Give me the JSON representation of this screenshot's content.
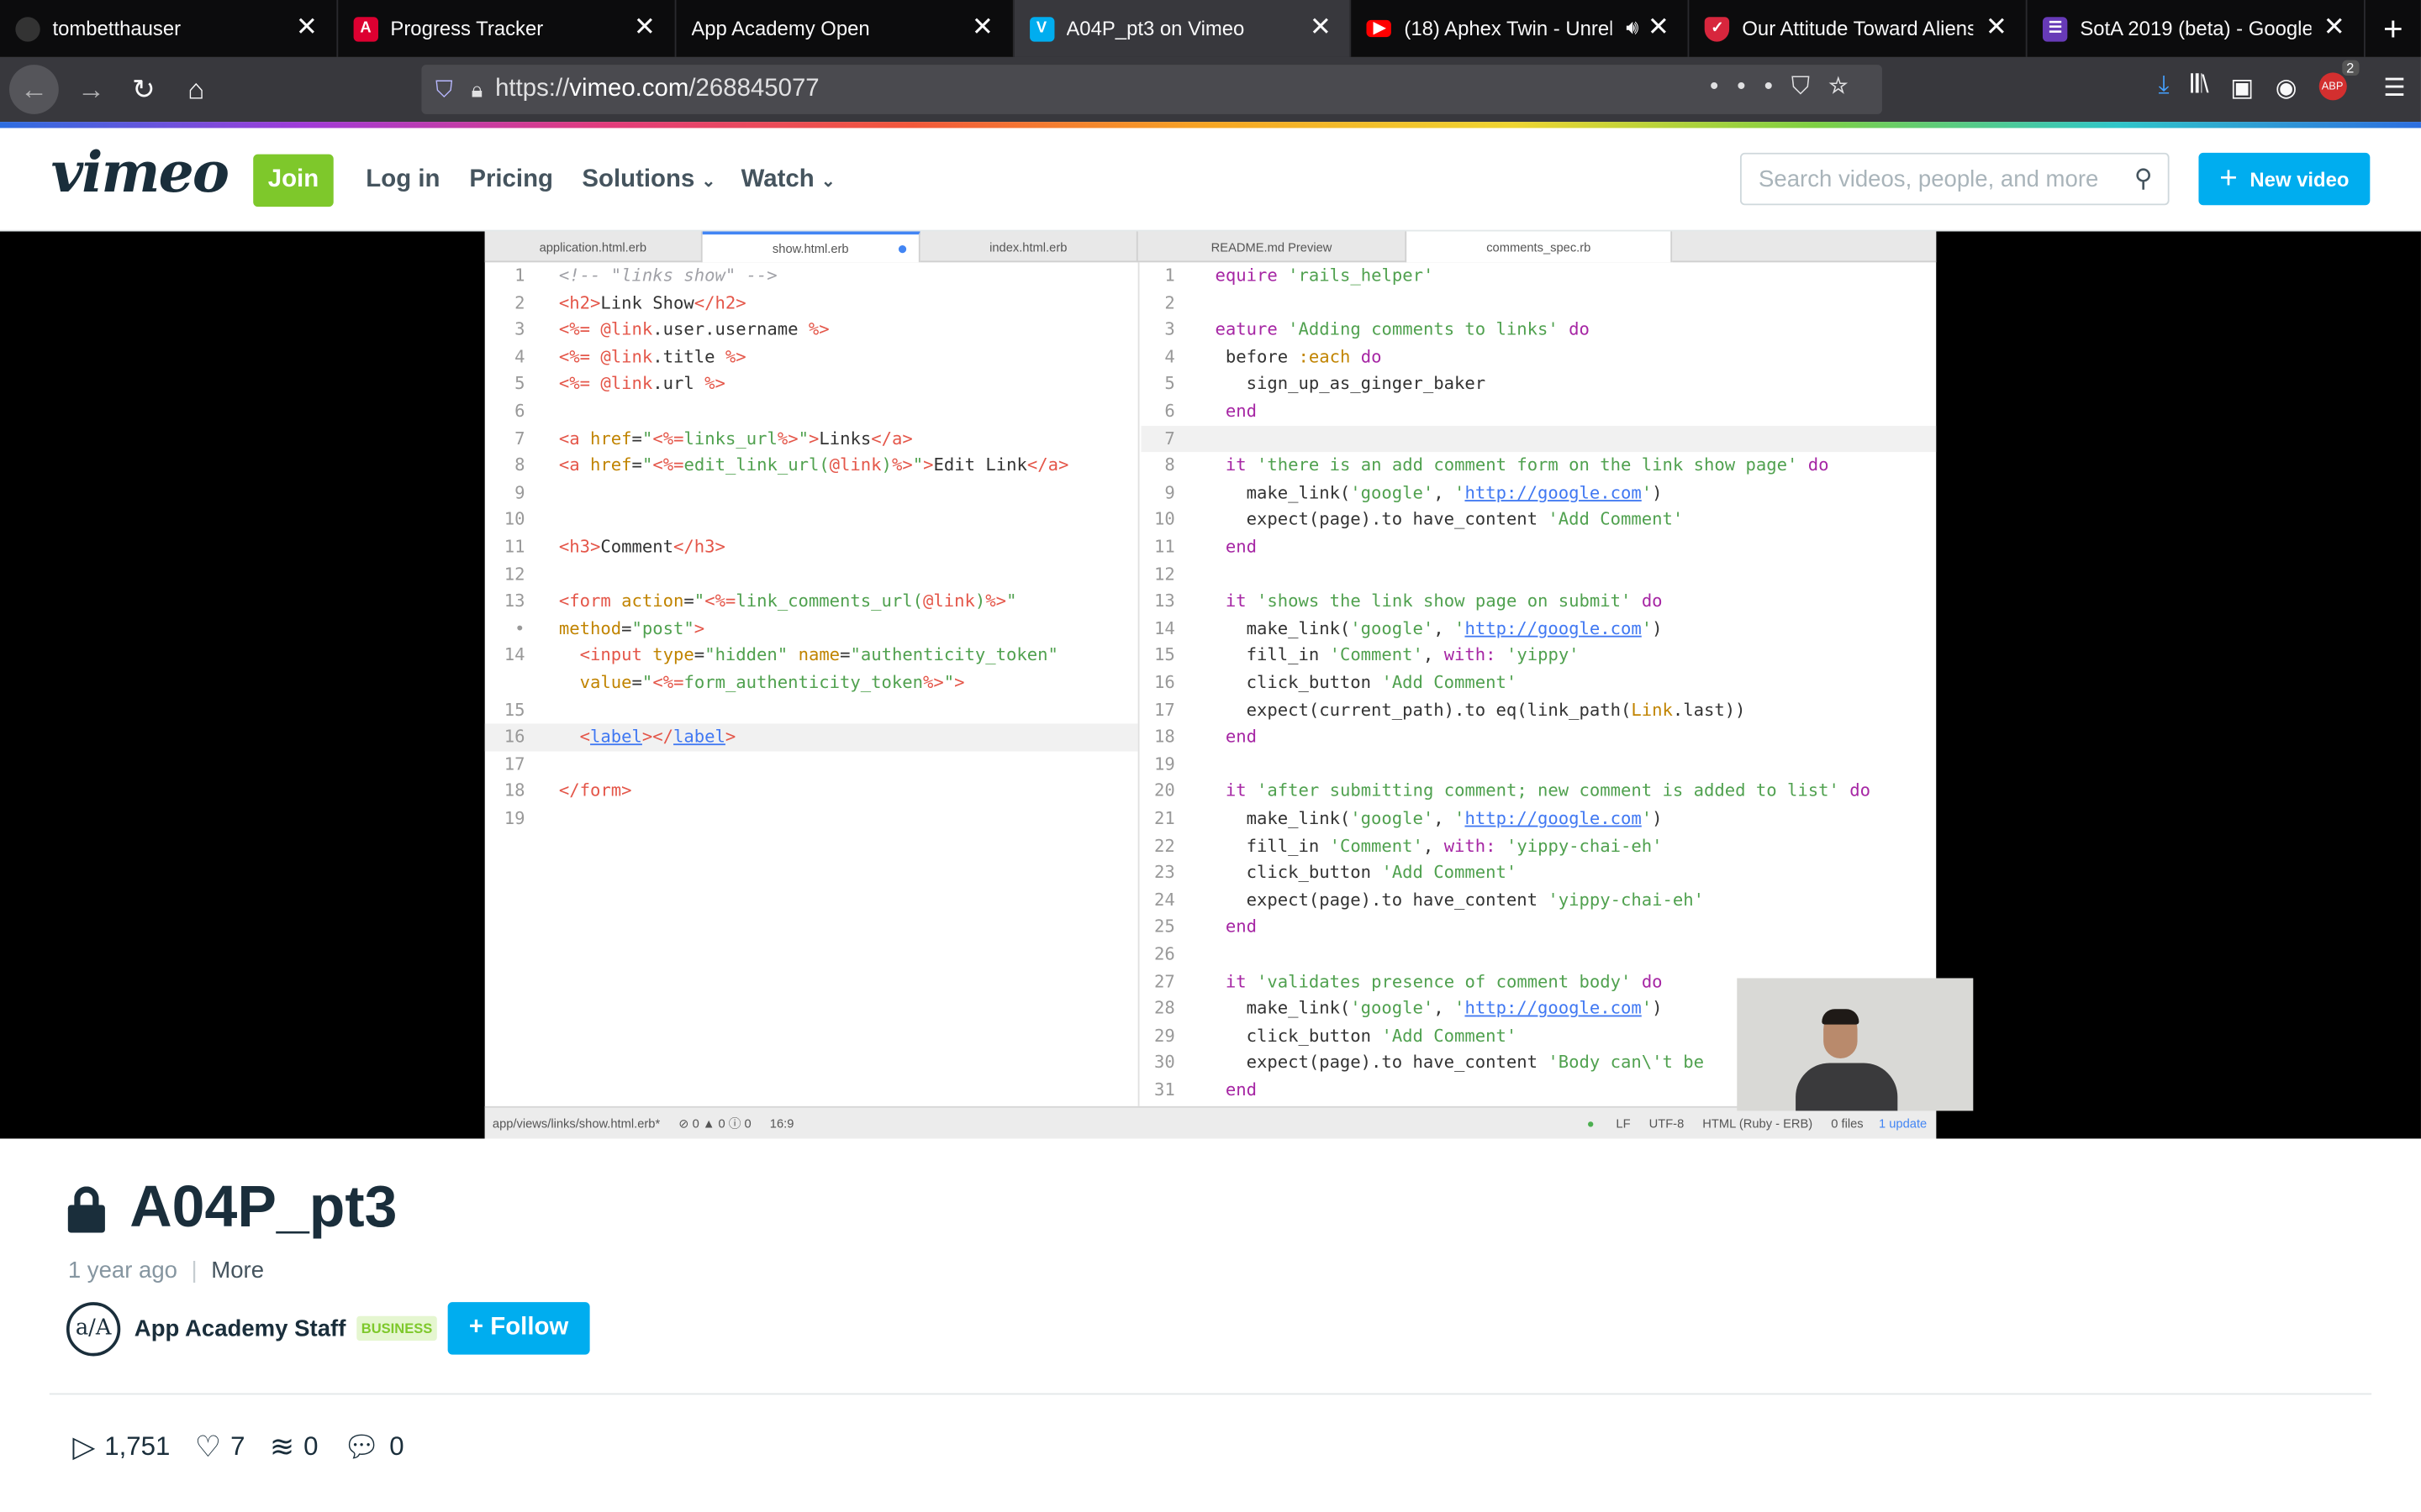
{
  "browser": {
    "tabs": [
      {
        "title": "tombetthauser",
        "icon_color": "#333333",
        "icon": "github-icon"
      },
      {
        "title": "Progress Tracker",
        "icon_color": "#dd0031",
        "icon": "angular-icon"
      },
      {
        "title": "App Academy Open",
        "icon_color": "#0c0c0d",
        "icon": "blank-icon"
      },
      {
        "title": "A04P_pt3 on Vimeo",
        "icon_color": "#00adef",
        "icon": "vimeo-icon",
        "active": true
      },
      {
        "title": "(18) Aphex Twin - Unrel",
        "icon_color": "#ff0000",
        "icon": "youtube-icon"
      },
      {
        "title": "Our Attitude Toward Aliens",
        "icon_color": "#d7263d",
        "icon": "pocket-icon"
      },
      {
        "title": "SotA 2019 (beta) - Google",
        "icon_color": "#673ab7",
        "icon": "forms-icon"
      }
    ],
    "url_prefix": "https://",
    "url_domain": "vimeo.com",
    "url_path": "/268845077",
    "notification_count": "2",
    "adblock_label": "ABP"
  },
  "header": {
    "logo": "vimeo",
    "join_label": "Join",
    "login_label": "Log in",
    "pricing_label": "Pricing",
    "solutions_label": "Solutions",
    "watch_label": "Watch",
    "search_placeholder": "Search videos, people, and more",
    "new_video_label": "New video"
  },
  "editor": {
    "tabs": [
      "application.html.erb",
      "show.html.erb",
      "index.html.erb",
      "README.md Preview",
      "comments_spec.rb"
    ],
    "left_lines": [
      {
        "n": "1",
        "html": "<span class='cm'>&lt;!-- \"links show\" --&gt;</span>"
      },
      {
        "n": "2",
        "html": "<span class='tg'>&lt;h2&gt;</span>Link Show<span class='tg'>&lt;/h2&gt;</span>"
      },
      {
        "n": "3",
        "html": "<span class='tg'>&lt;%=</span> <span class='tg'>@link</span>.user.username <span class='tg'>%&gt;</span>"
      },
      {
        "n": "4",
        "html": "<span class='tg'>&lt;%=</span> <span class='tg'>@link</span>.title <span class='tg'>%&gt;</span>"
      },
      {
        "n": "5",
        "html": "<span class='tg'>&lt;%=</span> <span class='tg'>@link</span>.url <span class='tg'>%&gt;</span>"
      },
      {
        "n": "6",
        "html": ""
      },
      {
        "n": "7",
        "html": "<span class='tg'>&lt;a</span> <span class='cn'>href</span>=<span class='st'>\"<span class='tg'>&lt;%=</span>links_url<span class='tg'>%&gt;</span>\"</span><span class='tg'>&gt;</span>Links<span class='tg'>&lt;/a&gt;</span>"
      },
      {
        "n": "8",
        "html": "<span class='tg'>&lt;a</span> <span class='cn'>href</span>=<span class='st'>\"<span class='tg'>&lt;%=</span>edit_link_url(<span class='tg'>@link</span>)<span class='tg'>%&gt;</span>\"</span><span class='tg'>&gt;</span>Edit Link<span class='tg'>&lt;/a&gt;</span>"
      },
      {
        "n": "9",
        "html": ""
      },
      {
        "n": "10",
        "html": ""
      },
      {
        "n": "11",
        "html": "<span class='tg'>&lt;h3&gt;</span>Comment<span class='tg'>&lt;/h3&gt;</span>"
      },
      {
        "n": "12",
        "html": ""
      },
      {
        "n": "13",
        "html": "<span class='tg'>&lt;form</span> <span class='cn'>action</span>=<span class='st'>\"<span class='tg'>&lt;%=</span>link_comments_url(<span class='tg'>@link</span>)<span class='tg'>%&gt;</span>\"</span>"
      },
      {
        "n": "•",
        "html": "<span class='cn'>method</span>=<span class='st'>\"post\"</span><span class='tg'>&gt;</span>"
      },
      {
        "n": "14",
        "html": "  <span class='tg'>&lt;input</span> <span class='cn'>type</span>=<span class='st'>\"hidden\"</span> <span class='cn'>name</span>=<span class='st'>\"authenticity_token\"</span>"
      },
      {
        "n": "",
        "html": "  <span class='cn'>value</span>=<span class='st'>\"<span class='tg'>&lt;%=</span>form_authenticity_token<span class='tg'>%&gt;</span>\"</span><span class='tg'>&gt;</span>"
      },
      {
        "n": "15",
        "html": ""
      },
      {
        "n": "16",
        "html": "  <span class='tg'>&lt;</span><span class='lk'>label</span><span class='tg'>&gt;&lt;/</span><span class='lk'>label</span><span class='tg'>&gt;</span>",
        "hl": true
      },
      {
        "n": "17",
        "html": ""
      },
      {
        "n": "18",
        "html": "<span class='tg'>&lt;/form&gt;</span>"
      },
      {
        "n": "19",
        "html": ""
      }
    ],
    "right_lines": [
      {
        "n": "1",
        "html": "<span class='kw'>equire</span> <span class='st'>'rails_helper'</span>"
      },
      {
        "n": "2",
        "html": ""
      },
      {
        "n": "3",
        "html": "<span class='kw'>eature</span> <span class='st'>'Adding comments to links'</span> <span class='kw'>do</span>"
      },
      {
        "n": "4",
        "html": " before <span class='cn'>:each</span> <span class='kw'>do</span>"
      },
      {
        "n": "5",
        "html": "   sign_up_as_ginger_baker"
      },
      {
        "n": "6",
        "html": " <span class='kw'>end</span>"
      },
      {
        "n": "7",
        "html": "",
        "hl": true
      },
      {
        "n": "8",
        "html": " <span class='kw'>it</span> <span class='st'>'there is an add comment form on the link show page'</span> <span class='kw'>do</span>"
      },
      {
        "n": "9",
        "html": "   make_link(<span class='st'>'google'</span>, <span class='st'>'<span class='lk'>http://google.com</span>'</span>)"
      },
      {
        "n": "10",
        "html": "   expect(page).to have_content <span class='st'>'Add Comment'</span>"
      },
      {
        "n": "11",
        "html": " <span class='kw'>end</span>"
      },
      {
        "n": "12",
        "html": ""
      },
      {
        "n": "13",
        "html": " <span class='kw'>it</span> <span class='st'>'shows the link show page on submit'</span> <span class='kw'>do</span>"
      },
      {
        "n": "14",
        "html": "   make_link(<span class='st'>'google'</span>, <span class='st'>'<span class='lk'>http://google.com</span>'</span>)"
      },
      {
        "n": "15",
        "html": "   fill_in <span class='st'>'Comment'</span>, <span class='kw'>with:</span> <span class='st'>'yippy'</span>"
      },
      {
        "n": "16",
        "html": "   click_button <span class='st'>'Add Comment'</span>"
      },
      {
        "n": "17",
        "html": "   expect(current_path).to eq(link_path(<span class='cn'>Link</span>.last))"
      },
      {
        "n": "18",
        "html": " <span class='kw'>end</span>"
      },
      {
        "n": "19",
        "html": ""
      },
      {
        "n": "20",
        "html": " <span class='kw'>it</span> <span class='st'>'after submitting comment; new comment is added to list'</span> <span class='kw'>do</span>"
      },
      {
        "n": "21",
        "html": "   make_link(<span class='st'>'google'</span>, <span class='st'>'<span class='lk'>http://google.com</span>'</span>)"
      },
      {
        "n": "22",
        "html": "   fill_in <span class='st'>'Comment'</span>, <span class='kw'>with:</span> <span class='st'>'yippy-chai-eh'</span>"
      },
      {
        "n": "23",
        "html": "   click_button <span class='st'>'Add Comment'</span>"
      },
      {
        "n": "24",
        "html": "   expect(page).to have_content <span class='st'>'yippy-chai-eh'</span>"
      },
      {
        "n": "25",
        "html": " <span class='kw'>end</span>"
      },
      {
        "n": "26",
        "html": ""
      },
      {
        "n": "27",
        "html": " <span class='kw'>it</span> <span class='st'>'validates presence of comment body'</span> <span class='kw'>do</span>"
      },
      {
        "n": "28",
        "html": "   make_link(<span class='st'>'google'</span>, <span class='st'>'<span class='lk'>http://google.com</span>'</span>)"
      },
      {
        "n": "29",
        "html": "   click_button <span class='st'>'Add Comment'</span>"
      },
      {
        "n": "30",
        "html": "   expect(page).to have_content <span class='st'>'Body can\\'t be</span>"
      },
      {
        "n": "31",
        "html": " <span class='kw'>end</span>"
      }
    ],
    "status_path": "app/views/links/show.html.erb*",
    "status_counts": "⊘ 0 ▲ 0 ⓘ 0",
    "status_aspect": "16:9",
    "status_lf": "LF",
    "status_enc": "UTF-8",
    "status_grammar": "HTML (Ruby - ERB)",
    "status_files": "0 files",
    "status_update": "1 update"
  },
  "video": {
    "title": "A04P_pt3",
    "age": "1 year ago",
    "more_label": "More",
    "owner": "App Academy Staff",
    "owner_initials": "a/A",
    "badge": "BUSINESS",
    "follow_label": "+ Follow",
    "plays": "1,751",
    "likes": "7",
    "collections": "0",
    "comments": "0"
  }
}
